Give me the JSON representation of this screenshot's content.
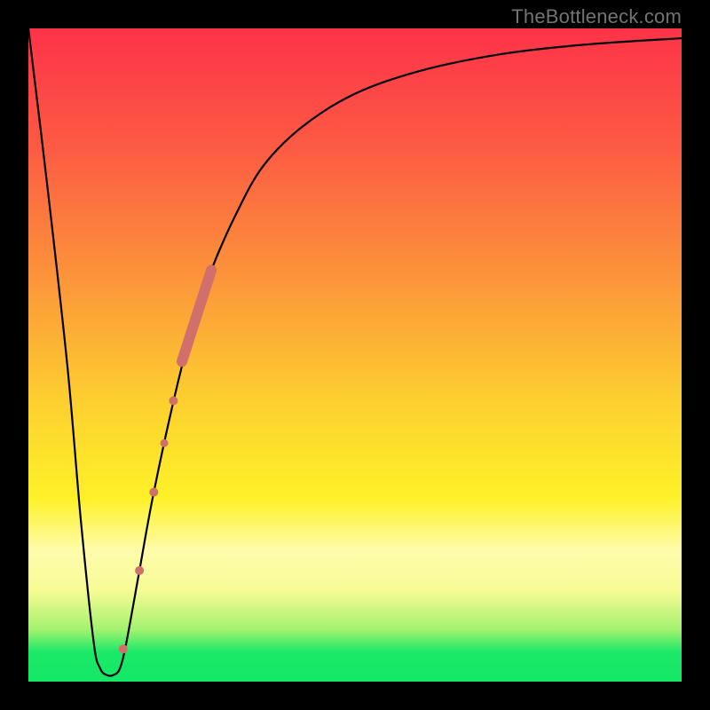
{
  "watermark": "TheBottleneck.com",
  "colors": {
    "frame": "#000000",
    "curve_stroke": "#000000",
    "marker_fill": "#d1706b",
    "marker_stroke": "#b85a55",
    "watermark": "#737373",
    "gradient_top": "#fe3647",
    "gradient_mid1": "#fc8f3b",
    "gradient_mid2": "#fee42b",
    "gradient_band": "#fdfbb0",
    "gradient_green": "#17e968"
  },
  "gradient_stops": [
    {
      "offset": 0.0,
      "color": "#fd3349"
    },
    {
      "offset": 0.18,
      "color": "#fd5a44"
    },
    {
      "offset": 0.38,
      "color": "#fc943a"
    },
    {
      "offset": 0.58,
      "color": "#fdd22f"
    },
    {
      "offset": 0.72,
      "color": "#fef128"
    },
    {
      "offset": 0.8,
      "color": "#fefcac"
    },
    {
      "offset": 0.86,
      "color": "#f7fb95"
    },
    {
      "offset": 0.92,
      "color": "#a4f26f"
    },
    {
      "offset": 0.955,
      "color": "#1ae967"
    },
    {
      "offset": 1.0,
      "color": "#13e967"
    }
  ],
  "chart_data": {
    "type": "line",
    "title": "",
    "xlabel": "",
    "ylabel": "",
    "xlim": [
      0,
      100
    ],
    "ylim": [
      0,
      100
    ],
    "grid": false,
    "legend": false,
    "series": [
      {
        "name": "bottleneck-curve",
        "x": [
          0,
          3,
          6,
          8,
          10,
          11,
          12,
          13,
          14,
          15,
          17,
          19,
          22,
          25,
          28,
          32,
          36,
          42,
          50,
          60,
          72,
          85,
          100
        ],
        "y": [
          100,
          75,
          48,
          25,
          6,
          2,
          1,
          1,
          2,
          6,
          17,
          28,
          42,
          54,
          63,
          72,
          79,
          85,
          90,
          93.5,
          96,
          97.5,
          98.5
        ]
      }
    ],
    "markers": [
      {
        "name": "segment",
        "x0": 23.5,
        "y0": 49.0,
        "x1": 28.0,
        "y1": 63.0,
        "r": 6
      },
      {
        "name": "dot",
        "x": 22.2,
        "y": 43.0,
        "r": 5
      },
      {
        "name": "dot",
        "x": 20.8,
        "y": 36.5,
        "r": 4.5
      },
      {
        "name": "dot",
        "x": 19.2,
        "y": 29.0,
        "r": 5
      },
      {
        "name": "dot",
        "x": 17.0,
        "y": 17.0,
        "r": 5
      },
      {
        "name": "dot",
        "x": 14.5,
        "y": 5.0,
        "r": 5
      }
    ]
  }
}
